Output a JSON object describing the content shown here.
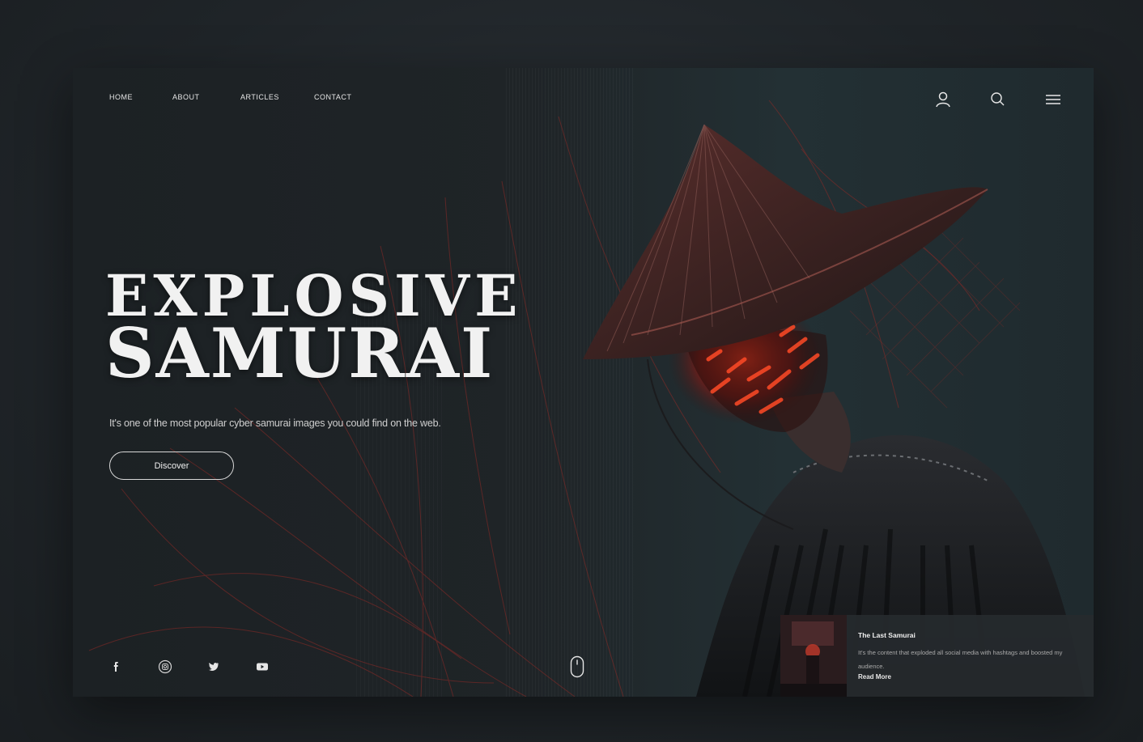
{
  "nav": {
    "items": [
      {
        "label": "HOME"
      },
      {
        "label": "ABOUT"
      },
      {
        "label": "ARTICLES"
      },
      {
        "label": "CONTACT"
      }
    ]
  },
  "header_icons": [
    "user-icon",
    "search-icon",
    "menu-icon"
  ],
  "hero": {
    "title_line1": "EXPLOSIVE",
    "title_line2": "SAMURAI",
    "subtitle": "It's one of the most popular cyber samurai images you could find on the web.",
    "cta_label": "Discover"
  },
  "social_icons": [
    "facebook-icon",
    "instagram-icon",
    "twitter-icon",
    "youtube-icon"
  ],
  "scroll_indicator": "mouse-icon",
  "card": {
    "title": "The Last Samurai",
    "description": "It's the content that exploded all social media with hashtags and boosted my audience.",
    "link_label": "Read More"
  },
  "colors": {
    "background": "#1f2428",
    "panel": "#1c2124",
    "accent_red": "#c8281e",
    "text": "#f1f1f1"
  }
}
